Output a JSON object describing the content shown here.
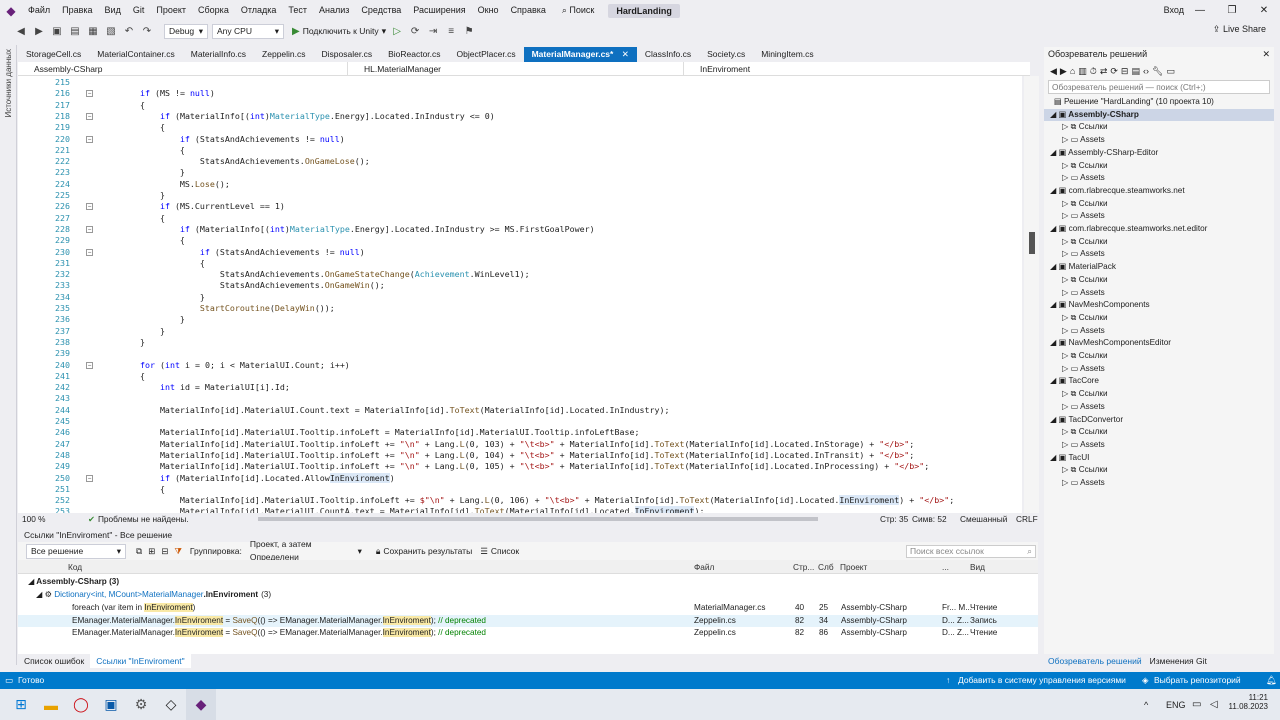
{
  "menubar": {
    "items": [
      "Файл",
      "Правка",
      "Вид",
      "Git",
      "Проект",
      "Сборка",
      "Отладка",
      "Тест",
      "Анализ",
      "Средства",
      "Расширения",
      "Окно",
      "Справка"
    ],
    "search": "Поиск",
    "solution_title": "HardLanding",
    "signin": "Вход"
  },
  "toolbar": {
    "config": "Debug",
    "platform": "Any CPU",
    "run": "Подключить к Unity",
    "live_share": "Live Share"
  },
  "left_strip": "Источники данных",
  "tabs": [
    {
      "label": "StorageCell.cs",
      "active": false
    },
    {
      "label": "MaterialContainer.cs",
      "active": false
    },
    {
      "label": "MaterialInfo.cs",
      "active": false
    },
    {
      "label": "Zeppelin.cs",
      "active": false
    },
    {
      "label": "Disposaler.cs",
      "active": false
    },
    {
      "label": "BioReactor.cs",
      "active": false
    },
    {
      "label": "ObjectPlacer.cs",
      "active": false
    },
    {
      "label": "MaterialManager.cs*",
      "active": true
    },
    {
      "label": "ClassInfo.cs",
      "active": false
    },
    {
      "label": "Society.cs",
      "active": false
    },
    {
      "label": "MiningItem.cs",
      "active": false
    }
  ],
  "navbar": {
    "project": "Assembly-CSharp",
    "class": "HL.MaterialManager",
    "member": "InEnviroment"
  },
  "code": [
    {
      "n": "215",
      "h": ""
    },
    {
      "n": "216",
      "h": "        <span class=\"k\">if</span> (MS != <span class=\"k\">null</span>)"
    },
    {
      "n": "217",
      "h": "        {"
    },
    {
      "n": "218",
      "h": "            <span class=\"k\">if</span> (MaterialInfo[(<span class=\"k\">int</span>)<span class=\"t\">MaterialType</span>.Energy].Located.InIndustry &lt;= 0)"
    },
    {
      "n": "219",
      "h": "            {"
    },
    {
      "n": "220",
      "h": "                <span class=\"k\">if</span> (StatsAndAchievements != <span class=\"k\">null</span>)"
    },
    {
      "n": "221",
      "h": "                {"
    },
    {
      "n": "222",
      "h": "                    StatsAndAchievements.<span class=\"m\">OnGameLose</span>();"
    },
    {
      "n": "223",
      "h": "                }"
    },
    {
      "n": "224",
      "h": "                MS.<span class=\"m\">Lose</span>();"
    },
    {
      "n": "225",
      "h": "            }"
    },
    {
      "n": "226",
      "h": "            <span class=\"k\">if</span> (MS.CurrentLevel == 1)"
    },
    {
      "n": "227",
      "h": "            {"
    },
    {
      "n": "228",
      "h": "                <span class=\"k\">if</span> (MaterialInfo[(<span class=\"k\">int</span>)<span class=\"t\">MaterialType</span>.Energy].Located.InIndustry &gt;= MS.FirstGoalPower)"
    },
    {
      "n": "229",
      "h": "                {"
    },
    {
      "n": "230",
      "h": "                    <span class=\"k\">if</span> (StatsAndAchievements != <span class=\"k\">null</span>)"
    },
    {
      "n": "231",
      "h": "                    {"
    },
    {
      "n": "232",
      "h": "                        StatsAndAchievements.<span class=\"m\">OnGameStateChange</span>(<span class=\"t\">Achievement</span>.WinLevel1);"
    },
    {
      "n": "233",
      "h": "                        StatsAndAchievements.<span class=\"m\">OnGameWin</span>();"
    },
    {
      "n": "234",
      "h": "                    }"
    },
    {
      "n": "235",
      "h": "                    <span class=\"m\">StartCoroutine</span>(<span class=\"m\">DelayWin</span>());"
    },
    {
      "n": "236",
      "h": "                }"
    },
    {
      "n": "237",
      "h": "            }"
    },
    {
      "n": "238",
      "h": "        }"
    },
    {
      "n": "239",
      "h": ""
    },
    {
      "n": "240",
      "h": "        <span class=\"k\">for</span> (<span class=\"k\">int</span> i = 0; i &lt; MaterialUI.Count; i++)"
    },
    {
      "n": "241",
      "h": "        {"
    },
    {
      "n": "242",
      "h": "            <span class=\"k\">int</span> id = MaterialUI[i].Id;"
    },
    {
      "n": "243",
      "h": ""
    },
    {
      "n": "244",
      "h": "            MaterialInfo[id].MaterialUI.Count.text = MaterialInfo[id].<span class=\"m\">ToText</span>(MaterialInfo[id].Located.InIndustry);"
    },
    {
      "n": "245",
      "h": ""
    },
    {
      "n": "246",
      "h": "            MaterialInfo[id].MaterialUI.Tooltip.infoLeft = MaterialInfo[id].MaterialUI.Tooltip.infoLeftBase;"
    },
    {
      "n": "247",
      "h": "            MaterialInfo[id].MaterialUI.Tooltip.infoLeft += <span class=\"s\">\"\\n\"</span> + Lang.<span class=\"m\">L</span>(0, 103) + <span class=\"s\">\"\\t&lt;b&gt;\"</span> + MaterialInfo[id].<span class=\"m\">ToText</span>(MaterialInfo[id].Located.InStorage) + <span class=\"s\">\"&lt;/b&gt;\"</span>;"
    },
    {
      "n": "248",
      "h": "            MaterialInfo[id].MaterialUI.Tooltip.infoLeft += <span class=\"s\">\"\\n\"</span> + Lang.<span class=\"m\">L</span>(0, 104) + <span class=\"s\">\"\\t&lt;b&gt;\"</span> + MaterialInfo[id].<span class=\"m\">ToText</span>(MaterialInfo[id].Located.InTransit) + <span class=\"s\">\"&lt;/b&gt;\"</span>;"
    },
    {
      "n": "249",
      "h": "            MaterialInfo[id].MaterialUI.Tooltip.infoLeft += <span class=\"s\">\"\\n\"</span> + Lang.<span class=\"m\">L</span>(0, 105) + <span class=\"s\">\"\\t&lt;b&gt;\"</span> + MaterialInfo[id].<span class=\"m\">ToText</span>(MaterialInfo[id].Located.InProcessing) + <span class=\"s\">\"&lt;/b&gt;\"</span>;"
    },
    {
      "n": "250",
      "h": "            <span class=\"k\">if</span> (MaterialInfo[id].Located.Allow<span class=\"hl\">InEnviroment</span>)"
    },
    {
      "n": "251",
      "h": "            {"
    },
    {
      "n": "252",
      "h": "                MaterialInfo[id].MaterialUI.Tooltip.infoLeft += <span class=\"s\">$\"\\n\"</span> + Lang.<span class=\"m\">L</span>(0, 106) + <span class=\"s\">\"\\t&lt;b&gt;\"</span> + MaterialInfo[id].<span class=\"m\">ToText</span>(MaterialInfo[id].Located.<span class=\"hl\">InEnviroment</span>) + <span class=\"s\">\"&lt;/b&gt;\"</span>;"
    },
    {
      "n": "253",
      "h": "                MaterialInfo[id].MaterialUI.CountA.text = MaterialInfo[id].<span class=\"m\">ToText</span>(MaterialInfo[id].Located.<span class=\"hl\">InEnviroment</span>);"
    }
  ],
  "editor_status": {
    "zoom": "100 %",
    "problems": "Проблемы не найдены.",
    "line": "Стр: 35",
    "col": "Симв: 52",
    "tabs": "Смешанный",
    "eol": "CRLF"
  },
  "refs": {
    "header": "Ссылки \"InEnviroment\" - Все решение",
    "scope": "Все решение",
    "grouping_label": "Группировка:",
    "grouping": "Проект, а затем Определени",
    "keep": "Сохранить результаты",
    "list": "Список",
    "search_placeholder": "Поиск всех ссылок",
    "columns": [
      "Код",
      "Файл",
      "Стр...",
      "Слб",
      "Проект",
      "...",
      "Вид"
    ],
    "group": "Assembly-CSharp (3)",
    "def": {
      "type": "Dictionary",
      "generic": "<int, MCount>",
      "owner": "MaterialManager",
      "name": ".InEnviroment",
      "count": "(3)"
    },
    "rows": [
      {
        "code": "foreach (var item in InEnviroment)",
        "file": "MaterialManager.cs",
        "line": "40",
        "col": "25",
        "project": "Assembly-CSharp",
        "extra": "Fr... M...",
        "kind": "Чтение"
      },
      {
        "code": "EManager.MaterialManager.InEnviroment = SaveQ(() => EManager.MaterialManager.InEnviroment); // deprecated",
        "file": "Zeppelin.cs",
        "line": "82",
        "col": "34",
        "project": "Assembly-CSharp",
        "extra": "D... Z...",
        "kind": "Запись"
      },
      {
        "code": "EManager.MaterialManager.InEnviroment = SaveQ(() => EManager.MaterialManager.InEnviroment); // deprecated",
        "file": "Zeppelin.cs",
        "line": "82",
        "col": "86",
        "project": "Assembly-CSharp",
        "extra": "D... Z...",
        "kind": "Чтение"
      }
    ]
  },
  "bottom_tabs": [
    "Список ошибок",
    "Ссылки \"InEnviroment\""
  ],
  "solution": {
    "title": "Обозреватель решений",
    "search": "Обозреватель решений — поиск (Ctrl+;)",
    "root": "Решение \"HardLanding\" (10 проекта 10)",
    "projects": [
      "Assembly-CSharp",
      "Assembly-CSharp-Editor",
      "com.rlabrecque.steamworks.net",
      "com.rlabrecque.steamworks.net.editor",
      "MaterialPack",
      "NavMeshComponents",
      "NavMeshComponentsEditor",
      "TacCore",
      "TacDConvertor",
      "TacUI"
    ],
    "refs_label": "Ссылки",
    "assets_label": "Assets"
  },
  "sol_tabs": [
    "Обозреватель решений",
    "Изменения Git"
  ],
  "statusbar": {
    "ready": "Готово",
    "vcs": "Добавить в систему управления версиями",
    "repo": "Выбрать репозиторий"
  },
  "taskbar": {
    "lang": "ENG",
    "time": "11:21",
    "date": "11.08.2023"
  }
}
